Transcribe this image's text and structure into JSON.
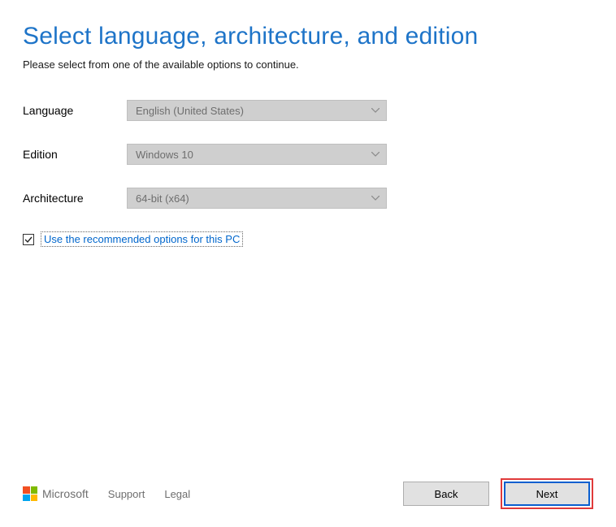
{
  "header": {
    "title": "Select language, architecture, and edition",
    "subtitle": "Please select from one of the available options to continue."
  },
  "form": {
    "language": {
      "label": "Language",
      "value": "English (United States)"
    },
    "edition": {
      "label": "Edition",
      "value": "Windows 10"
    },
    "architecture": {
      "label": "Architecture",
      "value": "64-bit (x64)"
    },
    "recommended": {
      "checked": true,
      "label": "Use the recommended options for this PC"
    }
  },
  "footer": {
    "brand": "Microsoft",
    "links": {
      "support": "Support",
      "legal": "Legal"
    },
    "buttons": {
      "back": "Back",
      "next": "Next"
    }
  }
}
